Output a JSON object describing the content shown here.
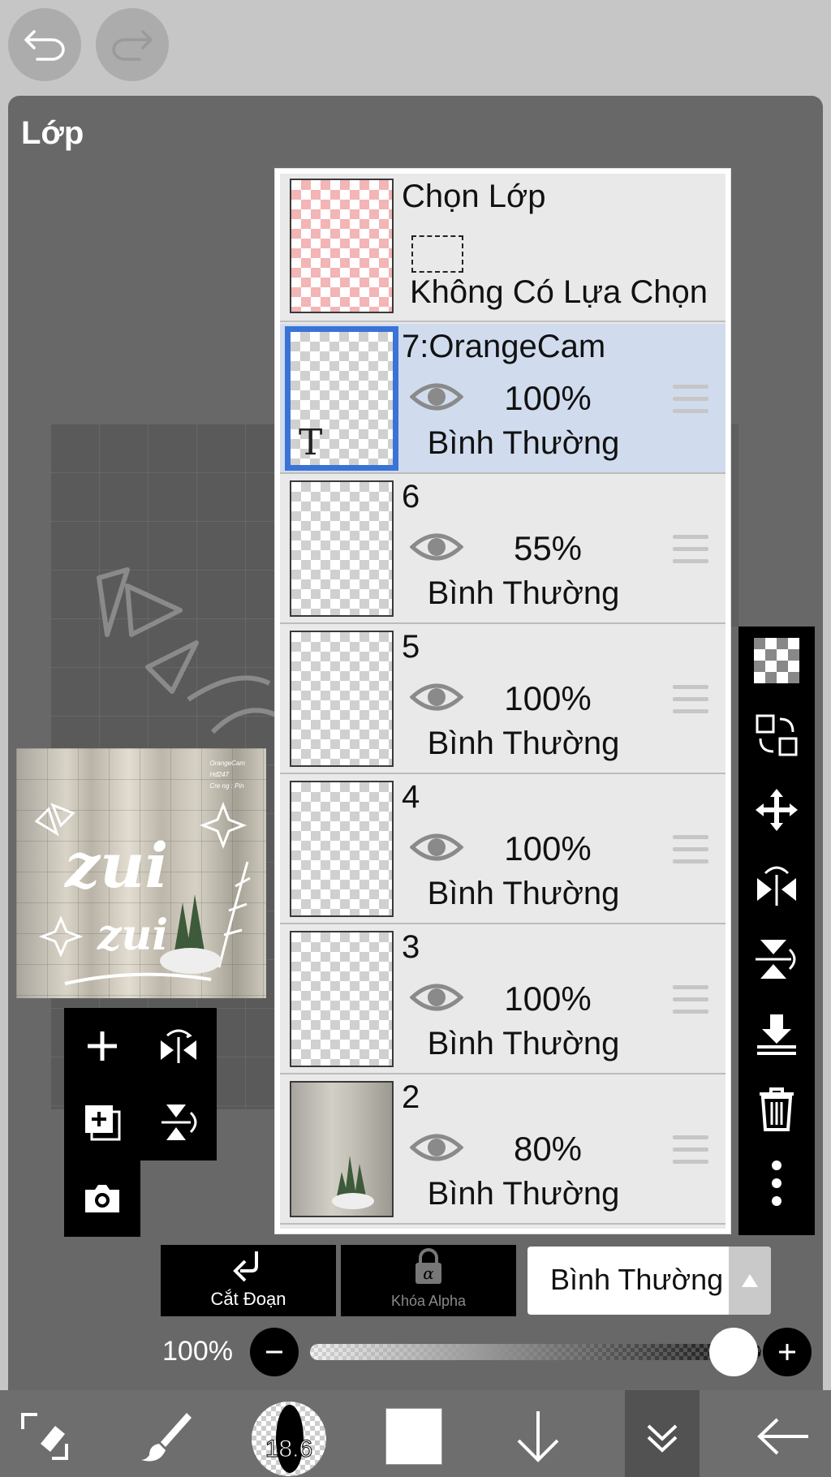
{
  "header": {
    "title": "Lớp"
  },
  "preview": {
    "info_lines": [
      "OrangeCam",
      "Hđ247",
      "Cre ng : Pin"
    ],
    "word1": "zui",
    "word2": "zui"
  },
  "selection_row": {
    "title": "Chọn Lớp",
    "status": "Không Có Lựa Chọn"
  },
  "layers": [
    {
      "name": "7:OrangeCam",
      "opacity": "100%",
      "mode": "Bình Thường",
      "active": true,
      "thumb_label": "T"
    },
    {
      "name": "6",
      "opacity": "55%",
      "mode": "Bình Thường"
    },
    {
      "name": "5",
      "opacity": "100%",
      "mode": "Bình Thường"
    },
    {
      "name": "4",
      "opacity": "100%",
      "mode": "Bình Thường"
    },
    {
      "name": "3",
      "opacity": "100%",
      "mode": "Bình Thường"
    },
    {
      "name": "2",
      "opacity": "80%",
      "mode": "Bình Thường"
    }
  ],
  "controls": {
    "clip_label": "Cắt Đoạn",
    "alpha_lock_label": "Khóa Alpha",
    "blend_mode": "Bình Thường",
    "opacity_label": "100%",
    "opacity_value": 1.0
  },
  "bottom": {
    "brush_size": "18.6",
    "color": "#ffffff"
  },
  "colors": {
    "active_layer_bg": "#d0dcee",
    "active_border": "#3a73d6",
    "panel": "#686868"
  }
}
